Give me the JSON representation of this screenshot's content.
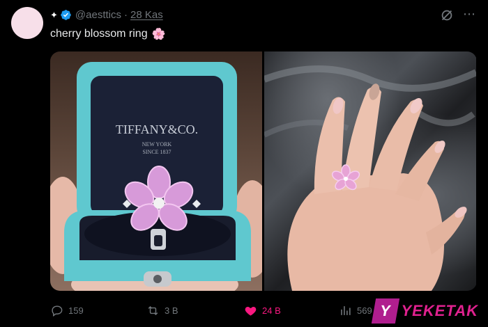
{
  "tweet": {
    "handle": "@aesttics",
    "separator": "·",
    "date": "28 Kas",
    "author_prefix_glyph": "✦",
    "text": "cherry blossom ring",
    "emoji": "🌸"
  },
  "media": {
    "left_image": {
      "box_brand": "TIFFANY&CO.",
      "box_city": "NEW YORK",
      "box_since": "SINCE 1837"
    },
    "right_image": {}
  },
  "actions": {
    "replies": "159",
    "reposts": "3 B",
    "likes": "24 B",
    "views": "569"
  },
  "watermark": {
    "badge": "Y",
    "text": "YEKETAK"
  },
  "colors": {
    "background": "#000000",
    "text_primary": "#e7e9ea",
    "text_secondary": "#71767b",
    "verified": "#1d9bf0",
    "like": "#f91880",
    "tiffany_blue": "#5fc8cf",
    "watermark": "#e0218f"
  },
  "icons": {
    "verified": "verified-badge-icon",
    "grok": "grok-icon",
    "more": "more-icon",
    "reply": "reply-icon",
    "repost": "repost-icon",
    "like": "heart-icon",
    "views": "views-icon"
  }
}
